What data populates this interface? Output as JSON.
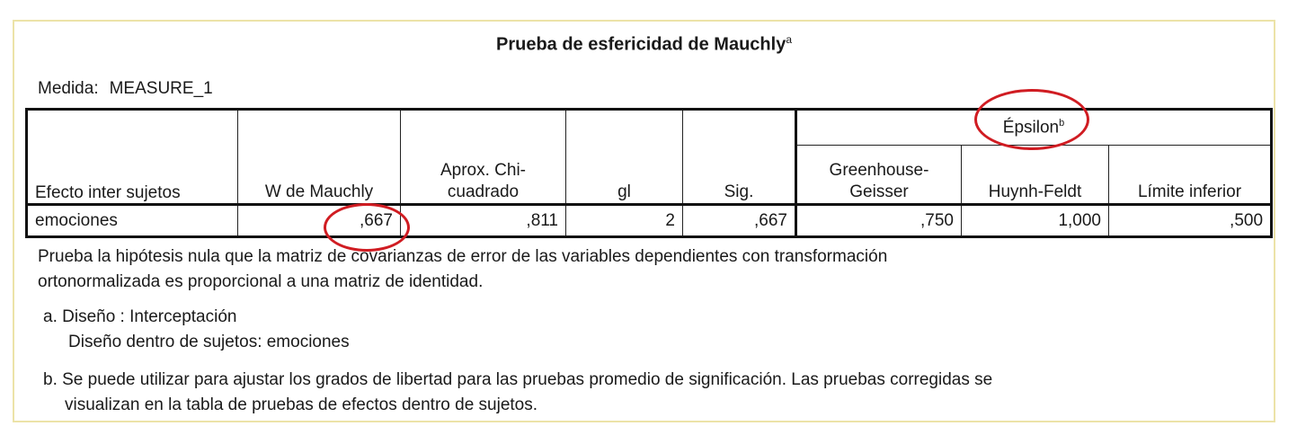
{
  "title": "Prueba de esfericidad de Mauchly",
  "title_sup": "a",
  "measure": {
    "label": "Medida:",
    "value": "MEASURE_1"
  },
  "headers": {
    "effect": "Efecto inter sujetos",
    "w": "W de Mauchly",
    "chi_line1": "Aprox. Chi-",
    "chi_line2": "cuadrado",
    "gl": "gl",
    "sig": "Sig.",
    "epsilon": "Épsilon",
    "epsilon_sup": "b",
    "gg_line1": "Greenhouse-",
    "gg_line2": "Geisser",
    "hf": "Huynh-Feldt",
    "lower": "Límite inferior"
  },
  "row": {
    "effect": "emociones",
    "w": ",667",
    "chi": ",811",
    "gl": "2",
    "sig": ",667",
    "gg": ",750",
    "hf": "1,000",
    "lower": ",500"
  },
  "notes": {
    "hyp_line1": "Prueba la hipótesis nula que la matriz de covarianzas de error de las variables dependientes con transformación",
    "hyp_line2": "ortonormalizada es proporcional a una matriz de identidad.",
    "a_line1": "a. Diseño : Interceptación",
    "a_line2": "Diseño dentro de sujetos: emociones",
    "b_line1": "b. Se puede utilizar para ajustar los grados de libertad para las pruebas promedio de significación. Las pruebas corregidas se",
    "b_line2": "visualizan en la tabla de pruebas de efectos dentro de sujetos."
  },
  "colors": {
    "annotation": "#d01c22",
    "frame": "#ece3a8"
  }
}
